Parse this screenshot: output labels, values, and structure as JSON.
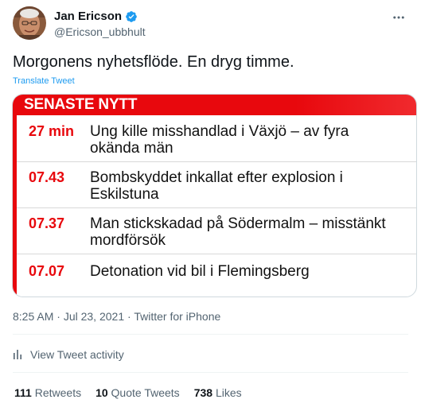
{
  "author": {
    "name": "Jan Ericson",
    "handle": "@Ericson_ubbhult"
  },
  "tweet": {
    "text": "Morgonens nyhetsflöde. En dryg timme.",
    "translate_label": "Translate Tweet"
  },
  "media": {
    "banner": "SENASTE NYTT",
    "items": [
      {
        "time": "27 min",
        "headline": "Ung kille misshandlad i Växjö – av fyra okända män"
      },
      {
        "time": "07.43",
        "headline": "Bombskyddet inkallat efter explosion i Eskilstuna"
      },
      {
        "time": "07.37",
        "headline": "Man stickskadad på Södermalm – misstänkt mordförsök"
      },
      {
        "time": "07.07",
        "headline": "Detonation vid bil i Flemingsberg"
      }
    ]
  },
  "meta": {
    "time": "8:25 AM",
    "separator": " · ",
    "date": "Jul 23, 2021",
    "source": "Twitter for iPhone"
  },
  "activity": {
    "label": "View Tweet activity"
  },
  "stats": {
    "retweets_count": "111",
    "retweets_label": "Retweets",
    "quotes_count": "10",
    "quotes_label": "Quote Tweets",
    "likes_count": "738",
    "likes_label": "Likes"
  },
  "colors": {
    "accent": "#1d9bf0",
    "news_red": "#e8080d",
    "secondary_text": "#536471"
  },
  "icons": {
    "verified": "verified-badge-icon",
    "more": "more-dots-icon",
    "activity": "bar-chart-icon"
  }
}
